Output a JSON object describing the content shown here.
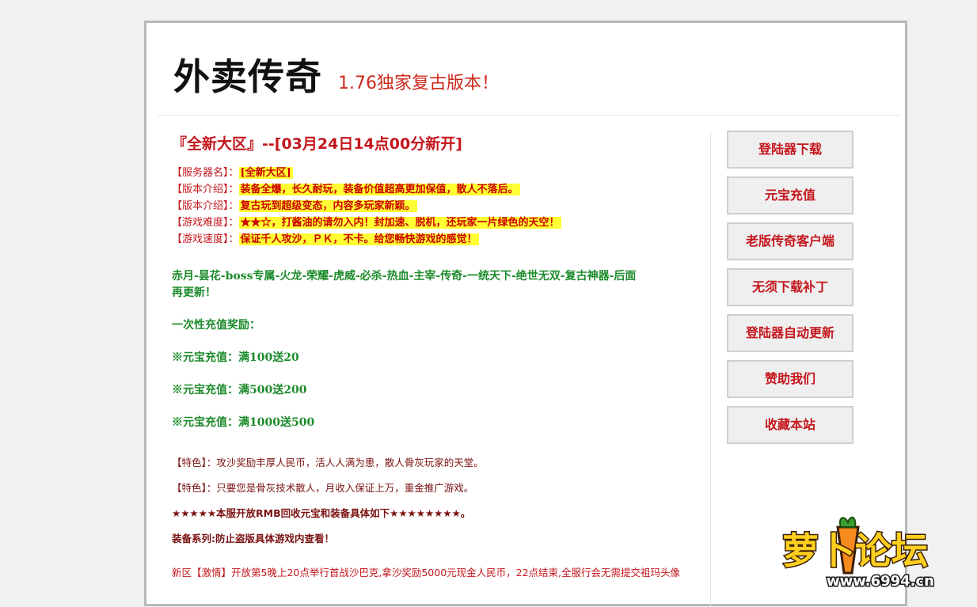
{
  "header": {
    "title": "外卖传奇",
    "subtitle": "1.76独家复古版本！"
  },
  "server": {
    "heading": "『全新大区』--[03月24日14点00分新开]",
    "info": [
      {
        "label": "【服务器名】：",
        "value": "[全新大区]"
      },
      {
        "label": "【版本介绍】：",
        "value": "装备全爆，长久耐玩，装备价值超高更加保值，散人不落后。"
      },
      {
        "label": "【版本介绍】：",
        "value": "复古玩到超级变态，内容多玩家新颖。"
      },
      {
        "label": "【游戏难度】：",
        "stars": "★★☆",
        "value": "，打酱油的请勿入内！封加速、脱机，还玩家一片绿色的天空！"
      },
      {
        "label": "【游戏速度】：",
        "value": "保证千人攻沙，ＰＫ，不卡。给您畅快游戏的感觉！"
      }
    ]
  },
  "items_line_1": "赤月-昙花-boss专属-火龙-荣耀-虎威-必杀-热血-主宰-传奇-一统天下-绝世无双-复古神器-后面",
  "items_line_2": "再更新！",
  "reward": {
    "title": "一次性充值奖励：",
    "lines": [
      "※元宝充值：满100送20",
      "※元宝充值：满500送200",
      "※元宝充值：满1000送500"
    ]
  },
  "features": {
    "line1": "【特色】：攻沙奖励丰厚人民币，活人人满为患，散人骨灰玩家的天堂。",
    "line2": "【特色】：只要您是骨灰技术散人，月收入保证上万，重金推广游戏。",
    "line3": "★★★★★本服开放RMB回收元宝和装备具体如下★★★★★★★★。",
    "line4": "装备系列:防止盗版具体游戏内查看！"
  },
  "news": "新区【激情】开放第5晚上20点举行首战沙巴克,拿沙奖励5000元现金人民币，22点结束,全服行会无需提交祖玛头像",
  "sidebar": {
    "buttons": [
      "登陆器下载",
      "元宝充值",
      "老版传奇客户端",
      "无须下载补丁",
      "登陆器自动更新",
      "赞助我们",
      "收藏本站"
    ]
  },
  "watermark": {
    "text": "萝卜论坛",
    "url_text": "www.6994.cn"
  }
}
